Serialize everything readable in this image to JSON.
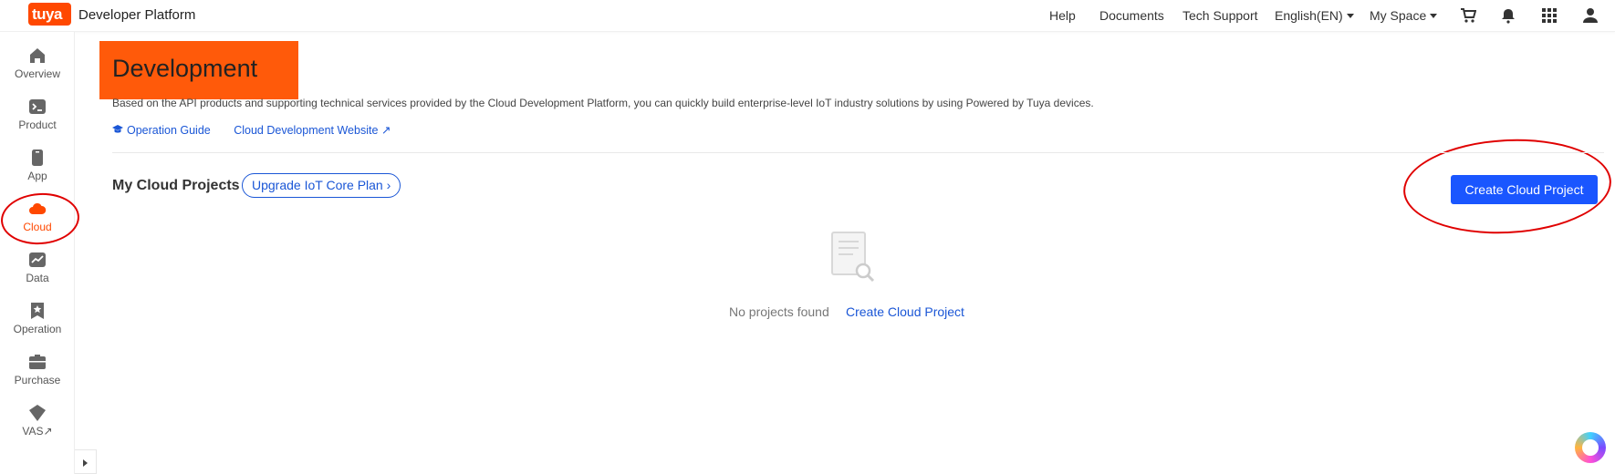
{
  "header": {
    "brand": "Developer Platform",
    "logo_text": "tuya",
    "nav": [
      "Help",
      "Documents",
      "Tech Support"
    ],
    "language": "English(EN)",
    "space": "My Space",
    "icons": [
      "cart-icon",
      "bell-icon",
      "apps-grid-icon",
      "user-icon"
    ]
  },
  "sidebar": {
    "items": [
      {
        "label": "Overview",
        "icon": "home-icon"
      },
      {
        "label": "Product",
        "icon": "terminal-icon"
      },
      {
        "label": "App",
        "icon": "phone-icon"
      },
      {
        "label": "Cloud",
        "icon": "cloud-icon",
        "active": true
      },
      {
        "label": "Data",
        "icon": "chart-icon"
      },
      {
        "label": "Operation",
        "icon": "star-badge-icon"
      },
      {
        "label": "Purchase",
        "icon": "box-icon"
      },
      {
        "label": "VAS",
        "icon": "diamond-icon"
      }
    ],
    "vas_ext": "↗"
  },
  "main": {
    "title": "Development",
    "description": "Based on the API products and supporting technical services provided by the Cloud Development Platform, you can quickly build enterprise-level IoT industry solutions by using Powered by Tuya devices.",
    "links": {
      "guide": "Operation Guide",
      "website": "Cloud Development Website",
      "website_ext": "↗"
    },
    "section_title": "My Cloud Projects",
    "upgrade_label": "Upgrade IoT Core Plan",
    "upgrade_chevron": "›",
    "create_button": "Create Cloud Project",
    "empty_text": "No projects found",
    "empty_link": "Create Cloud Project"
  },
  "colors": {
    "brand": "#ff4800",
    "primary": "#1a56ff",
    "annotation": "#e00000"
  }
}
